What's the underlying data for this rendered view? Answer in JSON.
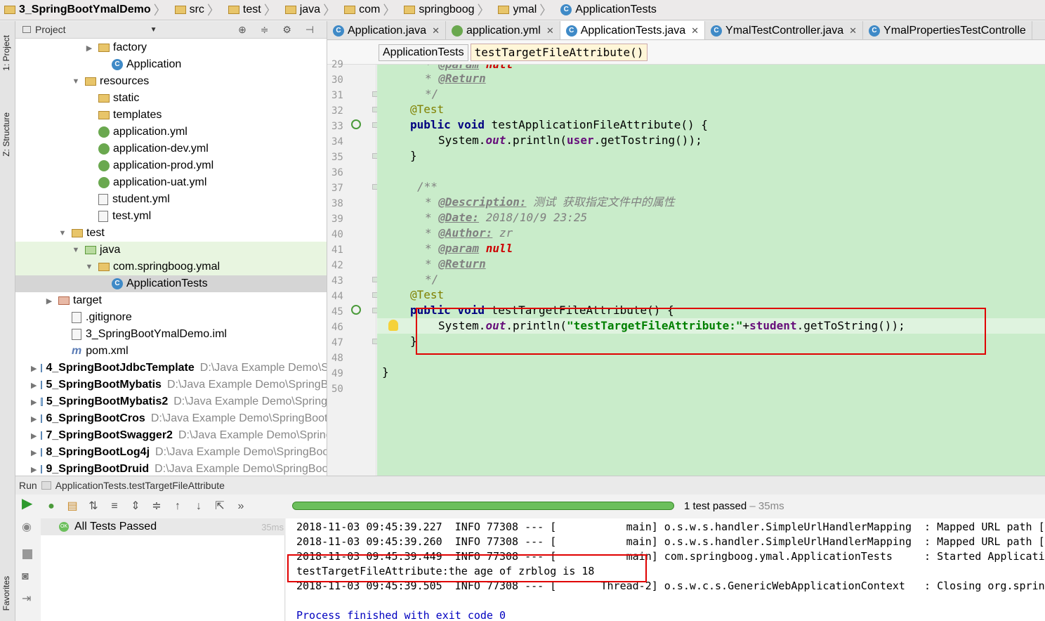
{
  "breadcrumb": [
    {
      "label": "3_SpringBootYmalDemo",
      "icon": "module-folder-icon"
    },
    {
      "label": "src",
      "icon": "folder-icon"
    },
    {
      "label": "test",
      "icon": "folder-icon"
    },
    {
      "label": "java",
      "icon": "folder-icon"
    },
    {
      "label": "com",
      "icon": "package-icon"
    },
    {
      "label": "springboog",
      "icon": "package-icon"
    },
    {
      "label": "ymal",
      "icon": "package-icon"
    },
    {
      "label": "ApplicationTests",
      "icon": "class-icon"
    }
  ],
  "left_strip": {
    "project_tab": "1: Project",
    "structure_tab": "Z: Structure",
    "favorites_tab": "Favorites"
  },
  "project_panel": {
    "title": "Project",
    "tree": [
      {
        "label": "factory",
        "indent": 1,
        "arrow": "▶",
        "icon": "folder"
      },
      {
        "label": "Application",
        "indent": 2,
        "arrow": "",
        "icon": "class"
      },
      {
        "label": "resources",
        "indent": 0,
        "arrow": "▼",
        "icon": "folder"
      },
      {
        "label": "static",
        "indent": 1,
        "arrow": "",
        "icon": "folder"
      },
      {
        "label": "templates",
        "indent": 1,
        "arrow": "",
        "icon": "folder"
      },
      {
        "label": "application.yml",
        "indent": 1,
        "arrow": "",
        "icon": "yml"
      },
      {
        "label": "application-dev.yml",
        "indent": 1,
        "arrow": "",
        "icon": "yml"
      },
      {
        "label": "application-prod.yml",
        "indent": 1,
        "arrow": "",
        "icon": "yml"
      },
      {
        "label": "application-uat.yml",
        "indent": 1,
        "arrow": "",
        "icon": "yml"
      },
      {
        "label": "student.yml",
        "indent": 1,
        "arrow": "",
        "icon": "file"
      },
      {
        "label": "test.yml",
        "indent": 1,
        "arrow": "",
        "icon": "file"
      },
      {
        "label": "test",
        "indent": -1,
        "arrow": "▼",
        "icon": "folder"
      },
      {
        "label": "java",
        "indent": 0,
        "arrow": "▼",
        "icon": "folder-green"
      },
      {
        "label": "com.springboog.ymal",
        "indent": 1,
        "arrow": "▼",
        "icon": "folder"
      },
      {
        "label": "ApplicationTests",
        "indent": 2,
        "arrow": "",
        "icon": "class"
      },
      {
        "label": "target",
        "indent": -2,
        "arrow": "▶",
        "icon": "folder-red"
      },
      {
        "label": ".gitignore",
        "indent": -1,
        "arrow": "",
        "icon": "file"
      },
      {
        "label": "3_SpringBootYmalDemo.iml",
        "indent": -1,
        "arrow": "",
        "icon": "file"
      },
      {
        "label": "pom.xml",
        "indent": -1,
        "arrow": "",
        "icon": "m"
      },
      {
        "label": "4_SpringBootJdbcTemplate",
        "path": "D:\\Java Example Demo\\Sp",
        "indent": -3,
        "arrow": "▶",
        "icon": "module"
      },
      {
        "label": "5_SpringBootMybatis",
        "path": "D:\\Java Example Demo\\SpringB",
        "indent": -3,
        "arrow": "▶",
        "icon": "module"
      },
      {
        "label": "5_SpringBootMybatis2",
        "path": "D:\\Java Example Demo\\Spring",
        "indent": -3,
        "arrow": "▶",
        "icon": "module"
      },
      {
        "label": "6_SpringBootCros",
        "path": "D:\\Java Example Demo\\SpringBoot",
        "indent": -3,
        "arrow": "▶",
        "icon": "module"
      },
      {
        "label": "7_SpringBootSwagger2",
        "path": "D:\\Java Example Demo\\Spring",
        "indent": -3,
        "arrow": "▶",
        "icon": "module"
      },
      {
        "label": "8_SpringBootLog4j",
        "path": "D:\\Java Example Demo\\SpringBoo",
        "indent": -3,
        "arrow": "▶",
        "icon": "module"
      },
      {
        "label": "9_SpringBootDruid",
        "path": "D:\\Java Example Demo\\SpringBoo",
        "indent": -3,
        "arrow": "▶",
        "icon": "module"
      }
    ]
  },
  "editor": {
    "tabs": [
      {
        "label": "Application.java",
        "icon": "class",
        "active": false
      },
      {
        "label": "application.yml",
        "icon": "yml",
        "active": false
      },
      {
        "label": "ApplicationTests.java",
        "icon": "class",
        "active": true
      },
      {
        "label": "YmalTestController.java",
        "icon": "class",
        "active": false
      },
      {
        "label": "YmalPropertiesTestControlle",
        "icon": "class",
        "active": false
      }
    ],
    "code_breadcrumb": [
      "ApplicationTests",
      "testTargetFileAttribute()"
    ],
    "line_numbers": [
      "29",
      "30",
      "31",
      "32",
      "33",
      "34",
      "35",
      "36",
      "37",
      "38",
      "39",
      "40",
      "41",
      "42",
      "43",
      "44",
      "45",
      "46",
      "47",
      "48",
      "49",
      "50"
    ],
    "lines": {
      "l29_tag": "@param",
      "l29_val": "null",
      "l30_tag": "@Return",
      "l31": "*/",
      "l32": "@Test",
      "l33_kw": "public void",
      "l33_rest": " testApplicationFileAttribute() {",
      "l34_a": "System.",
      "l34_out": "out",
      "l34_b": ".println(",
      "l34_var": "user",
      "l34_c": ".getTostring());",
      "l35": "}",
      "l37": "/**",
      "l38_tag": "@Description:",
      "l38_text": " 测试 获取指定文件中的属性",
      "l39_tag": "@Date:",
      "l39_text": " 2018/10/9 23:25",
      "l40_tag": "@Author:",
      "l40_text": " zr",
      "l41_tag": "@param",
      "l41_val": "null",
      "l42_tag": "@Return",
      "l43": "*/",
      "l44": "@Test",
      "l45_kw": "public void",
      "l45_rest": " testTargetFileAttribute() {",
      "l46_a": "System.",
      "l46_out": "out",
      "l46_b": ".println(",
      "l46_str": "\"testTargetFileAttribute:\"",
      "l46_plus": "+",
      "l46_var": "student",
      "l46_c": ".getToString());",
      "l47": "}",
      "l49": "}"
    }
  },
  "run_panel": {
    "title": "Run",
    "config": "ApplicationTests.testTargetFileAttribute",
    "result": "1 test passed",
    "result_time": " – 35ms",
    "progress": 1.0,
    "tree_root": "All Tests Passed",
    "tree_time": "35ms",
    "console": [
      "2018-11-03 09:45:39.227  INFO 77308 --- [           main] o.s.w.s.handler.SimpleUrlHandlerMapping  : Mapped URL path [/",
      "2018-11-03 09:45:39.260  INFO 77308 --- [           main] o.s.w.s.handler.SimpleUrlHandlerMapping  : Mapped URL path [/",
      "2018-11-03 09:45:39.449  INFO 77308 --- [           main] com.springboog.ymal.ApplicationTests     : Started Applicatio",
      "testTargetFileAttribute:the age of zrblog is 18",
      "2018-11-03 09:45:39.505  INFO 77308 --- [       Thread-2] o.s.w.c.s.GenericWebApplicationContext   : Closing org.spring",
      "",
      "Process finished with exit code 0"
    ]
  },
  "colors": {
    "code_bg": "#c9ecca",
    "highlight_box": "#e00000",
    "progress": "#6cbf5c"
  }
}
